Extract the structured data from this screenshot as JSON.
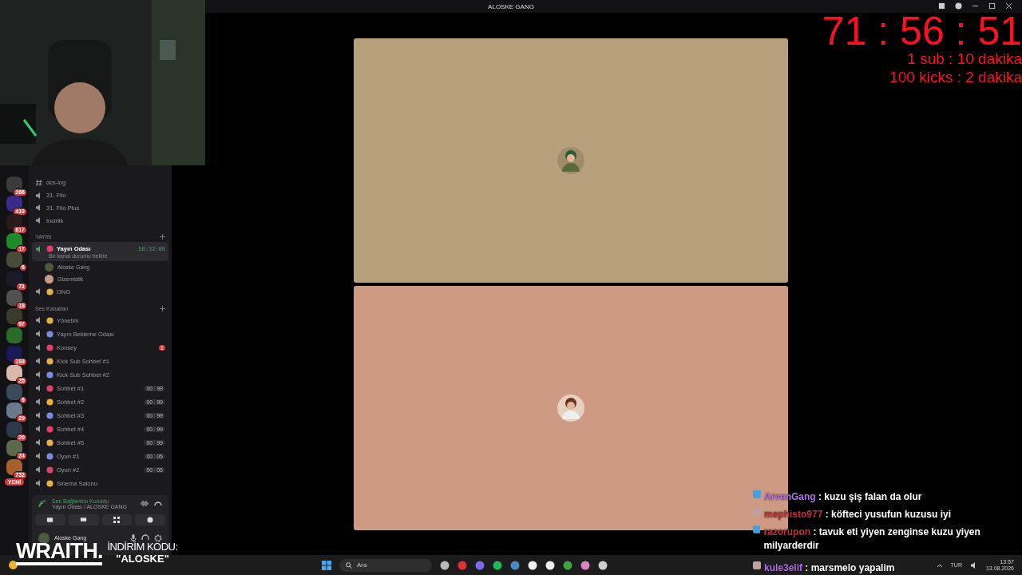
{
  "window": {
    "title": "ALOSKE GANG"
  },
  "servers": [
    {
      "badge": "266",
      "color": "#3a3a3a"
    },
    {
      "badge": "410",
      "color": "#3b2a8a"
    },
    {
      "badge": "817",
      "color": "#2a1a1a"
    },
    {
      "badge": "17",
      "color": "#1f8a2a"
    },
    {
      "badge": "6",
      "color": "#4a4a3a"
    },
    {
      "badge": "71",
      "color": "#1a1a2a"
    },
    {
      "badge": "18",
      "color": "#505050"
    },
    {
      "badge": "97",
      "color": "#3a3a2a"
    },
    {
      "color": "#2a6a2a"
    },
    {
      "badge": "193",
      "color": "#1a1a5a"
    },
    {
      "badge": "25",
      "color": "#d8b8a8"
    },
    {
      "badge": "6",
      "color": "#3a4a5a"
    },
    {
      "badge": "29",
      "color": "#6a7a8a"
    },
    {
      "badge": "20",
      "color": "#2a3a4a"
    },
    {
      "badge": "24",
      "color": "#5a6a4a"
    },
    {
      "badge": "732",
      "color": "#a8602a"
    }
  ],
  "new_badge": "YENİ",
  "channels": [
    {
      "kind": "text",
      "name": "dcs-log"
    },
    {
      "kind": "voice",
      "name": "31. Filo"
    },
    {
      "kind": "voice",
      "name": "31. Filo Plus"
    },
    {
      "kind": "voice",
      "name": "İncirlik"
    }
  ],
  "categories": [
    {
      "name": "YAYIN",
      "channels": [
        {
          "name": "Yayın Odası",
          "selected": true,
          "time": "58:32:08",
          "status": "Bir kanal durumu belirle",
          "members": [
            "Aloske Gang",
            "Gizemistik"
          ]
        },
        {
          "name": "ONG",
          "selected": false
        }
      ]
    },
    {
      "name": "Ses Kanalları",
      "channels": [
        {
          "name": "Yönetim",
          "selected": false
        },
        {
          "name": "Yayın Bekleme Odası",
          "selected": false
        },
        {
          "name": "Konsey",
          "selected": false,
          "mentions": "1"
        },
        {
          "name": "Kick Sub Sohbet #1",
          "selected": false
        },
        {
          "name": "Kick Sub Sohbet #2",
          "selected": false
        },
        {
          "name": "Sohbet #1",
          "selected": false,
          "users": "00",
          "limit": "99"
        },
        {
          "name": "Sohbet #2",
          "selected": false,
          "users": "00",
          "limit": "99"
        },
        {
          "name": "Sohbet #3",
          "selected": false,
          "users": "00",
          "limit": "99"
        },
        {
          "name": "Sohbet #4",
          "selected": false,
          "users": "00",
          "limit": "99"
        },
        {
          "name": "Sohbet #5",
          "selected": false,
          "users": "00",
          "limit": "99"
        },
        {
          "name": "Oyun #1",
          "selected": false,
          "users": "00",
          "limit": "05"
        },
        {
          "name": "Oyun #2",
          "selected": false,
          "users": "00",
          "limit": "05"
        },
        {
          "name": "Sinema Salonu",
          "selected": false
        }
      ]
    }
  ],
  "voice_panel": {
    "status": "Ses Bağlantısı Kuruldu",
    "location": "Yayın Odası / ALOSKE GANG"
  },
  "user_panel": {
    "name": "Aloske Gang"
  },
  "tiles": [
    {
      "color": "#b8a07c"
    },
    {
      "color": "#cf9a84"
    }
  ],
  "timer": {
    "value": "71 : 56 : 51",
    "lines": [
      "1 sub : 10 dakika",
      "100 kicks : 2 dakika"
    ]
  },
  "chat": [
    {
      "user": "ArvenGang",
      "color": "#b46ee6",
      "text": ": kuzu şiş falan da olur"
    },
    {
      "user": "mephisto977",
      "color": "#c0303a",
      "text": ": köfteci yusufun kuzusu iyi"
    },
    {
      "user": "razorupon",
      "color": "#c0303a",
      "text": ": tavuk eti yiyen zenginse kuzu yiyen milyarderdir"
    },
    {
      "user": "kule3elif",
      "color": "#b46ee6",
      "text": ": marsmelo yapalim"
    }
  ],
  "promo": {
    "brand": "WRAITH.",
    "label": "İNDİRİM KODU:",
    "code": "\"ALOSKE\""
  },
  "taskbar": {
    "search": "Ara",
    "language": "TUR",
    "time": "13:57",
    "date": "13.08.2026"
  }
}
